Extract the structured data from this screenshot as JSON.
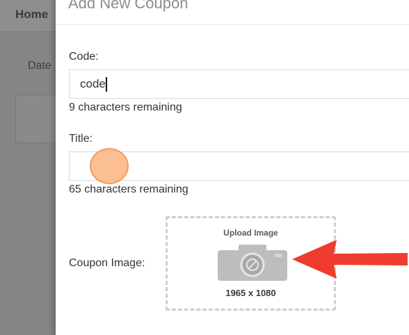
{
  "background": {
    "nav_home": "Home",
    "date_label": "Date"
  },
  "modal": {
    "title": "Add New Coupon",
    "code": {
      "label": "Code:",
      "value": "code",
      "help": "9 characters remaining"
    },
    "title_field": {
      "label": "Title:",
      "value": "",
      "help": "65 characters remaining"
    },
    "coupon_image": {
      "label": "Coupon Image:",
      "upload_title": "Upload Image",
      "upload_size": "1965 x 1080"
    }
  },
  "colors": {
    "overlay": "#858585",
    "arrow": "#f03c2e",
    "cursor_highlight": "#f8a96a"
  },
  "icons": [
    "camera-icon",
    "red-arrow-annotation-icon"
  ]
}
